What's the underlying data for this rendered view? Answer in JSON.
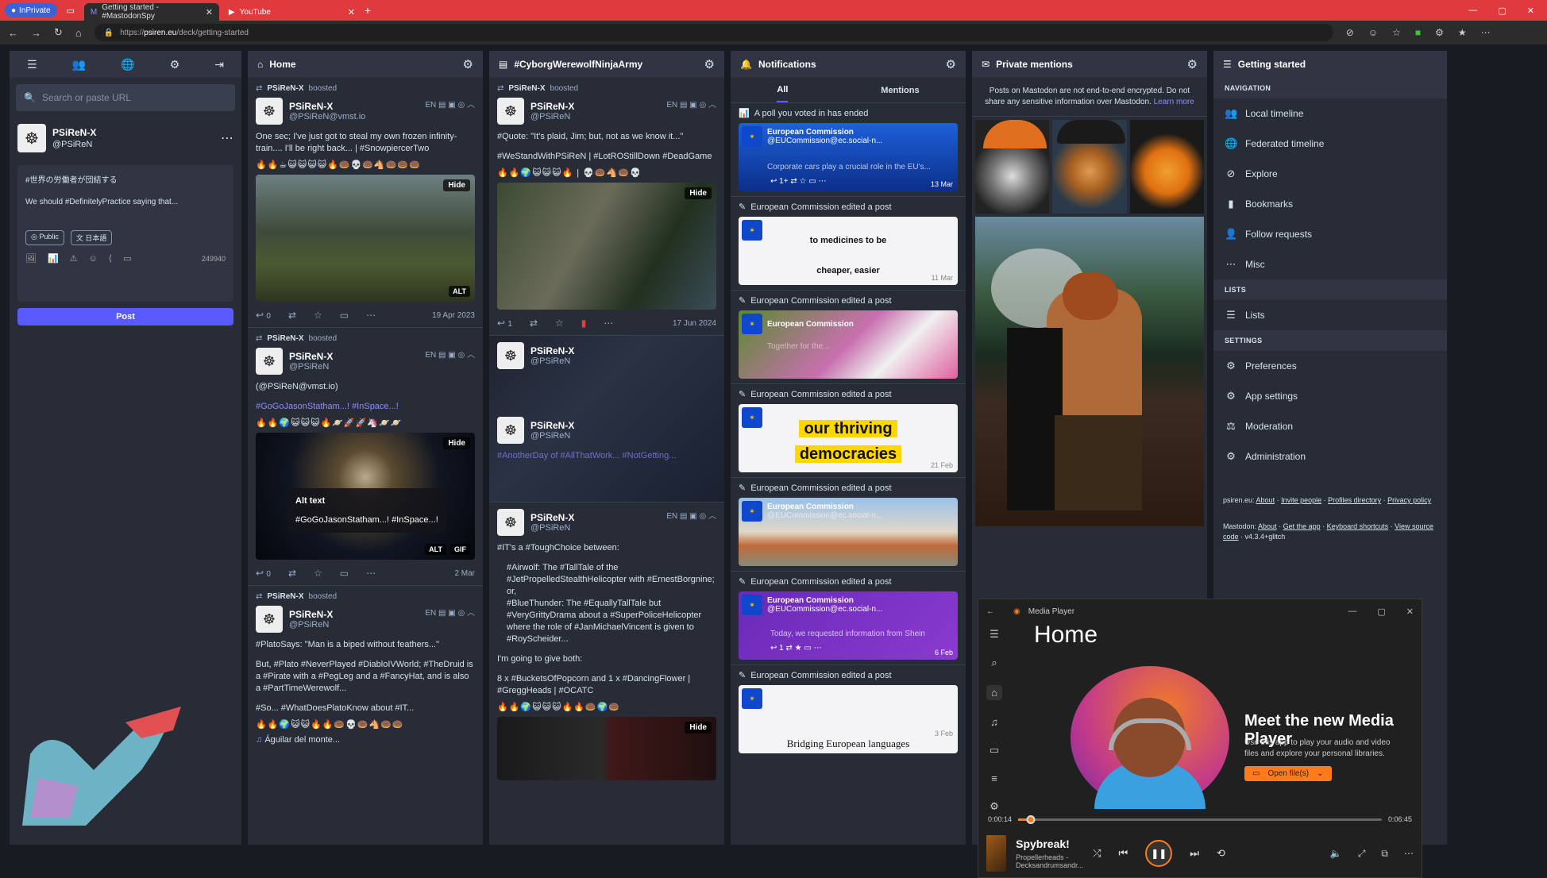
{
  "browser": {
    "private_label": "InPrivate",
    "tab1_title": "Getting started - #MastodonSpy",
    "tab2_title": "YouTube",
    "url_prefix": "https://",
    "url_host": "psiren.eu",
    "url_path": "/deck/getting-started"
  },
  "compose_col": {
    "search_placeholder": "Search or paste URL",
    "account_name": "PSiReN-X",
    "account_handle": "@PSiReN",
    "draft_line1": "#世界の労働者が団結する",
    "draft_line2": "We should #DefinitelyPractice saying that...",
    "visibility": "Public",
    "language": "日本語",
    "char_count": "249940",
    "post_label": "Post"
  },
  "home": {
    "title": "Home",
    "s1": {
      "boost": "PSiReN-X",
      "boost_suffix": "boosted",
      "name": "PSiReN-X",
      "handle": "@PSiReN@vmst.io",
      "meta": "EN",
      "text": "One sec; I've just got to steal my own frozen infinity-train.... I'll be right back... | #SnowpiercerTwo",
      "emoji": "🔥🔥☕😺😺😺😺🔥🍩💀🍩🐴🍩🍩🍩",
      "hide": "Hide",
      "alt": "ALT",
      "replies": "0",
      "date": "19 Apr 2023"
    },
    "s2": {
      "boost": "PSiReN-X",
      "boost_suffix": "boosted",
      "name": "PSiReN-X",
      "handle": "@PSiReN",
      "meta": "EN",
      "text1": "(@PSiReN@vmst.io)",
      "text2": "#GoGoJasonStatham...! #InSpace...!",
      "emoji": "🔥🔥🌍😺😺😺🔥🪐🚀🚀🦄🪐🪐",
      "hide": "Hide",
      "alt_title": "Alt text",
      "alt_text": "#GoGoJasonStatham...! #InSpace...!",
      "alt": "ALT",
      "gif": "GIF",
      "replies": "0",
      "date": "2 Mar"
    },
    "s3": {
      "boost": "PSiReN-X",
      "boost_suffix": "boosted",
      "name": "PSiReN-X",
      "handle": "@PSiReN",
      "meta": "EN",
      "text1": "#PlatoSays: \"Man is a biped without feathers...\"",
      "text2": "But, #Plato #NeverPlayed #DiabloIVWorld; #TheDruid is a #Pirate with a #PegLeg and a #FancyHat, and is also a #PartTimeWerewolf...",
      "text3": "#So... #WhatDoesPlatoKnow about #IT...",
      "emoji": "🔥🔥🌍😺😺🔥🔥🍩💀🍩🐴🍩🍩",
      "music": "Águilar del monte..."
    }
  },
  "tag": {
    "title": "#CyborgWerewolfNinjaArmy",
    "s1": {
      "boost": "PSiReN-X",
      "boost_suffix": "boosted",
      "name": "PSiReN-X",
      "handle": "@PSiReN",
      "meta": "EN",
      "text1": "#Quote: \"It's plaid, Jim; but, not as we know it...\"",
      "text2": "#WeStandWithPSiReN | #LotROStillDown #DeadGame",
      "emoji": "🔥🔥🌍😺😺😺🔥 | 💀🍩🐴🍩💀",
      "hide": "Hide",
      "replies": "1",
      "date": "17 Jun 2024"
    },
    "s2": {
      "name": "PSiReN-X",
      "handle": "@PSiReN",
      "nested_name": "PSiReN-X",
      "nested_handle": "@PSiReN",
      "nested_text": "#AnotherDay of #AllThatWork... #NotGetting..."
    },
    "s3": {
      "name": "PSiReN-X",
      "handle": "@PSiReN",
      "meta": "EN",
      "text1": "#IT's a #ToughChoice between:",
      "b1": "#Airwolf: The #TallTale of the #JetPropelledStealthHelicopter with #ErnestBorgnine; or,",
      "b2": "#BlueThunder: The #EquallyTallTale but #VeryGrittyDrama about a #SuperPoliceHelicopter where the role of #JanMichaelVincent is given to #RoyScheider...",
      "text2": "I'm going to give both:",
      "text3": "8 x #BucketsOfPopcorn and 1 x #DancingFlower | #GreggHeads | #OCATC",
      "emoji": "🔥🔥🌍😺😺😺🔥🔥🍩🌍🍩",
      "hide": "Hide"
    }
  },
  "notifications": {
    "title": "Notifications",
    "tab_all": "All",
    "tab_mentions": "Mentions",
    "poll_label": "A poll you voted in has ended",
    "account_name": "European Commission",
    "account_handle": "@EUCommission@ec.social-n...",
    "meta": "EN",
    "edited_label": "European Commission edited a post",
    "card1_text": "Corporate cars play a crucial role in the EU's...",
    "card1_date": "13 Mar",
    "card1_replies": "1+",
    "card2_big1": "to medicines to be",
    "card2_big2": "cheaper, easier",
    "card2_date": "11 Mar",
    "card3_text": "Together for the...",
    "card4_big1": "our thriving",
    "card4_big2": "democracies",
    "card4_date": "21 Feb",
    "card6_text": "Today, we requested information from Shein",
    "card6_date": "6 Feb",
    "card6_replies": "1",
    "card7_big": "Bridging European languages",
    "card7_date": "3 Feb"
  },
  "private": {
    "title": "Private mentions",
    "warning": "Posts on Mastodon are not end-to-end encrypted. Do not share any sensitive information over Mastodon.",
    "learn_more": "Learn more"
  },
  "getting_started": {
    "title": "Getting started",
    "sec_nav": "NAVIGATION",
    "local": "Local timeline",
    "federated": "Federated timeline",
    "explore": "Explore",
    "bookmarks": "Bookmarks",
    "follow_requests": "Follow requests",
    "misc": "Misc",
    "sec_lists": "LISTS",
    "lists": "Lists",
    "sec_settings": "SETTINGS",
    "preferences": "Preferences",
    "app_settings": "App settings",
    "moderation": "Moderation",
    "administration": "Administration",
    "foot1_site": "psiren.eu:",
    "foot1_about": "About",
    "foot1_invite": "Invite people",
    "foot1_profiles": "Profiles directory",
    "foot1_privacy": "Privacy policy",
    "foot2_site": "Mastodon:",
    "foot2_about": "About",
    "foot2_app": "Get the app",
    "foot2_keys": "Keyboard shortcuts",
    "foot2_view": "View source code",
    "foot2_ver": "v4.3.4+glitch"
  },
  "media_player": {
    "app_title": "Media Player",
    "page_title": "Home",
    "promo_title": "Meet the new Media Player",
    "promo_sub": "Use this app to play your audio and video files and explore your personal libraries.",
    "open_label": "Open file(s)",
    "time_elapsed": "0:00:14",
    "time_total": "0:06:45",
    "progress_fraction": 0.035,
    "track_title": "Spybreak!",
    "track_artist": "Propellerheads - Decksandrumsandr..."
  },
  "colors": {
    "accent": "#595aff",
    "hashtag": "#8c8dff",
    "browser_bar": "#e0393e",
    "player_accent": "#ff7a1a"
  }
}
